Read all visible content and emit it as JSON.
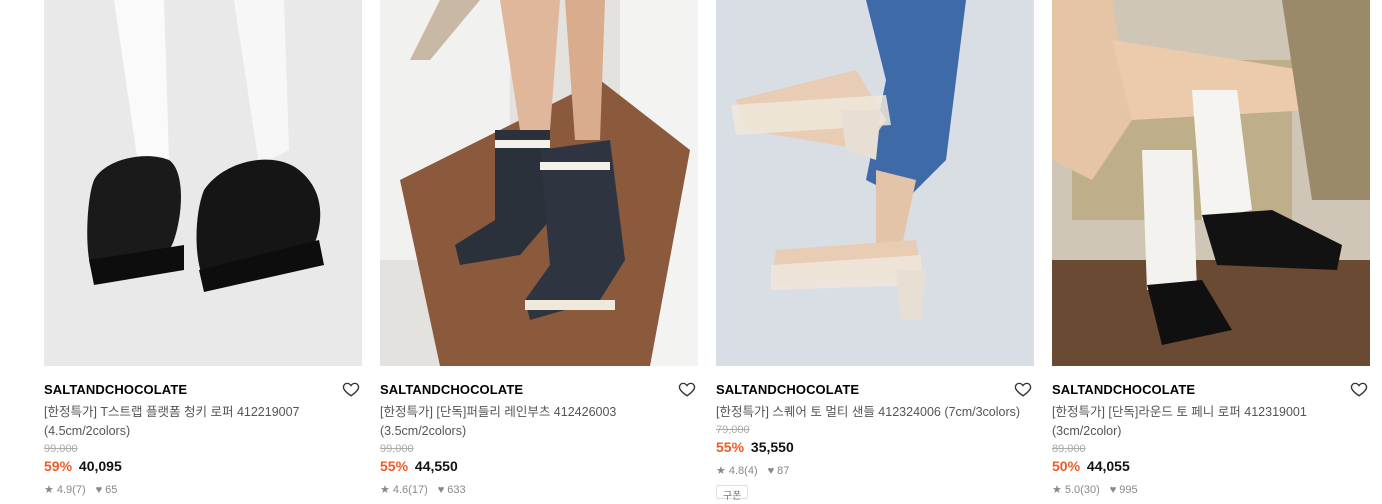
{
  "products": [
    {
      "brand": "SALTANDCHOCOLATE",
      "title_line1": "[한정특가] T스트랩 플랫폼 청키 로퍼 412219007",
      "title_line2": "(4.5cm/2colors)",
      "original_price": "99,000",
      "discount": "59%",
      "price": "40,095",
      "rating": "4.9",
      "review_count": "(7)",
      "likes": "65",
      "image_alt": "black woven platform loafers with white socks"
    },
    {
      "brand": "SALTANDCHOCOLATE",
      "title_line1": "[한정특가] [단독]퍼들리 레인부츠 412426003",
      "title_line2": "(3.5cm/2colors)",
      "original_price": "99,000",
      "discount": "55%",
      "price": "44,550",
      "rating": "4.6",
      "review_count": "(17)",
      "likes": "633",
      "image_alt": "navy rain boots on doormat steps"
    },
    {
      "brand": "SALTANDCHOCOLATE",
      "title_line1": "[한정특가] 스퀘어 토 멀티 샌들 412324006 (7cm/3colors)",
      "title_line2": "",
      "original_price": "79,000",
      "discount": "55%",
      "price": "35,550",
      "rating": "4.8",
      "review_count": "(4)",
      "likes": "87",
      "tag": "구폰",
      "image_alt": "ivory strappy block heel sandals with jeans"
    },
    {
      "brand": "SALTANDCHOCOLATE",
      "title_line1": "[한정특가] [단독]라운드 토 페니 로퍼 412319001",
      "title_line2": "(3cm/2color)",
      "original_price": "89,000",
      "discount": "50%",
      "price": "44,055",
      "rating": "5.0",
      "review_count": "(30)",
      "likes": "995",
      "image_alt": "black penny loafers with white slouch socks"
    }
  ],
  "icons": {
    "like": "heart-outline-icon",
    "star": "star-icon",
    "likes": "heart-filled-icon"
  },
  "colors": {
    "discount": "#f05a28",
    "text": "#000000",
    "muted": "#888888"
  }
}
